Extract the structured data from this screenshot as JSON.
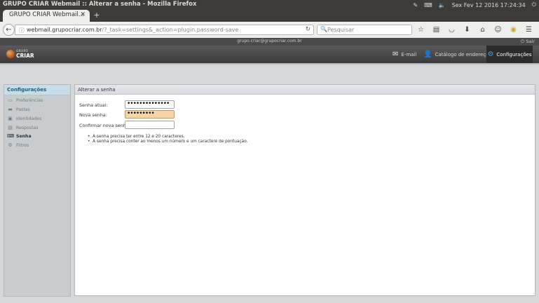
{
  "window": {
    "title": "GRUPO CRIAR Webmail :: Alterar a senha - Mozilla Firefox",
    "clock": "Sex Fev 12 2016 17:24:34",
    "tray_icons": [
      "pen-icon",
      "keyboard-icon",
      "volume-icon",
      "power-icon"
    ]
  },
  "browser": {
    "tab_label": "GRUPO CRIAR Webmail...",
    "url_host": "webmail.grupocriar.com.br",
    "url_path": "/?_task=settings&_action=plugin.password-save",
    "search_placeholder": "Pesquisar",
    "toolbar_icons": [
      "star-icon",
      "reading-list-icon",
      "pocket-icon",
      "download-icon",
      "home-icon",
      "chat-icon",
      "extension-icon",
      "menu-icon"
    ]
  },
  "webmail": {
    "user_email": "grupo.criar@grupocriar.com.br",
    "logout_label": "Sair",
    "logo_line1": "GRUPO",
    "logo_line2": "CRIAR",
    "nav": {
      "mail": "E-mail",
      "contacts": "Catálogo de endereços",
      "settings": "Configurações"
    },
    "sidebar": {
      "heading": "Configurações",
      "items": [
        {
          "label": "Preferências",
          "icon": "preferences-icon",
          "active": false
        },
        {
          "label": "Pastas",
          "icon": "folder-icon",
          "active": false
        },
        {
          "label": "Identidades",
          "icon": "identity-icon",
          "active": false
        },
        {
          "label": "Respostas",
          "icon": "responses-icon",
          "active": false
        },
        {
          "label": "Senha",
          "icon": "password-icon",
          "active": true
        },
        {
          "label": "Filtros",
          "icon": "filter-icon",
          "active": false
        }
      ]
    },
    "panel": {
      "heading": "Alterar a senha",
      "current_label": "Senha atual:",
      "current_value": "••••••••••••••",
      "new_label": "Nova senha:",
      "new_value": "•••••••••",
      "confirm_label": "Confirmar nova senha:",
      "confirm_value": "",
      "rules": [
        "A senha precisa ter entre 12 e 20 caracteres.",
        "A senha precisa conter ao menos um número e um caractere de pontuação."
      ]
    }
  }
}
